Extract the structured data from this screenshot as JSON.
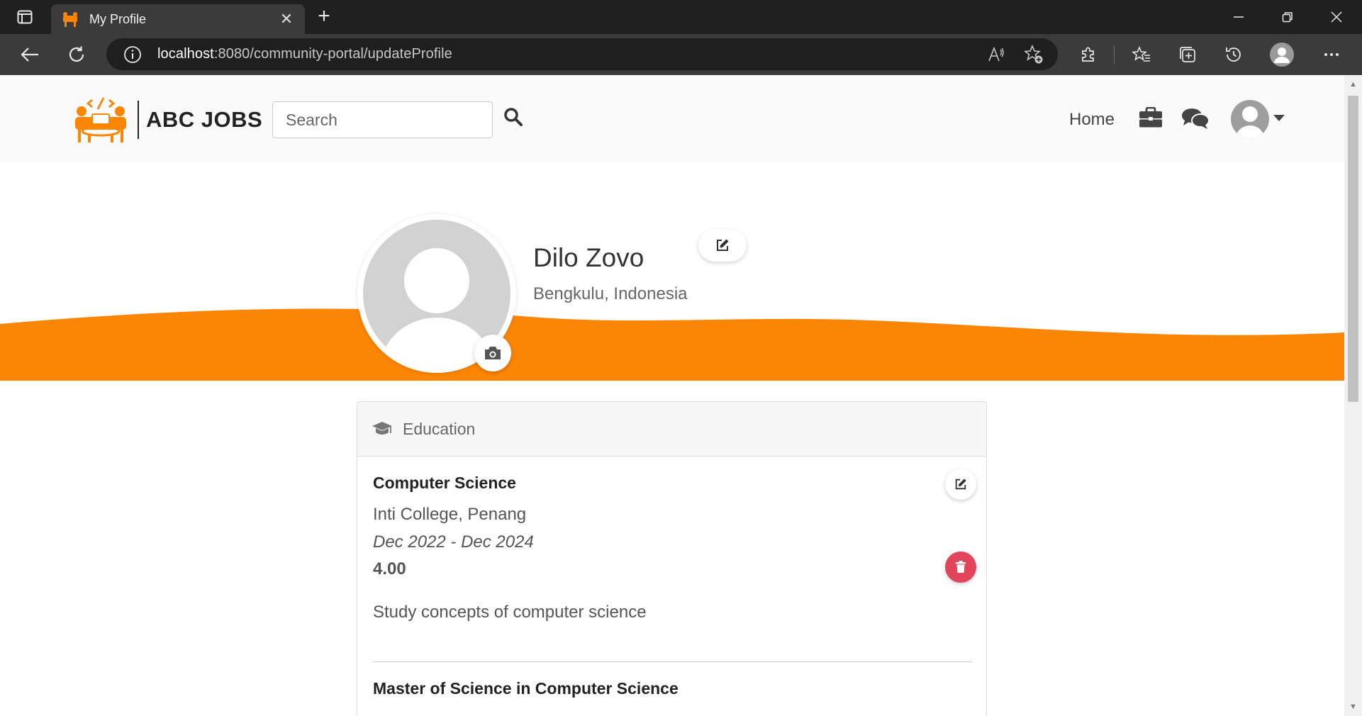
{
  "browser": {
    "tab_title": "My Profile",
    "url_host": "localhost",
    "url_path": ":8080/community-portal/updateProfile"
  },
  "navbar": {
    "brand": "ABC JOBS",
    "search_placeholder": "Search",
    "home_label": "Home"
  },
  "profile": {
    "name": "Dilo Zovo",
    "location": "Bengkulu, Indonesia"
  },
  "education": {
    "title": "Education",
    "entries": [
      {
        "degree": "Computer Science",
        "school": "Inti College, Penang",
        "dates": "Dec 2022 - Dec 2024",
        "gpa": "4.00",
        "description": "Study concepts of computer science"
      },
      {
        "degree": "Master of Science in Computer Science"
      }
    ]
  },
  "colors": {
    "accent": "#fb8505",
    "delete": "#e2445c"
  }
}
